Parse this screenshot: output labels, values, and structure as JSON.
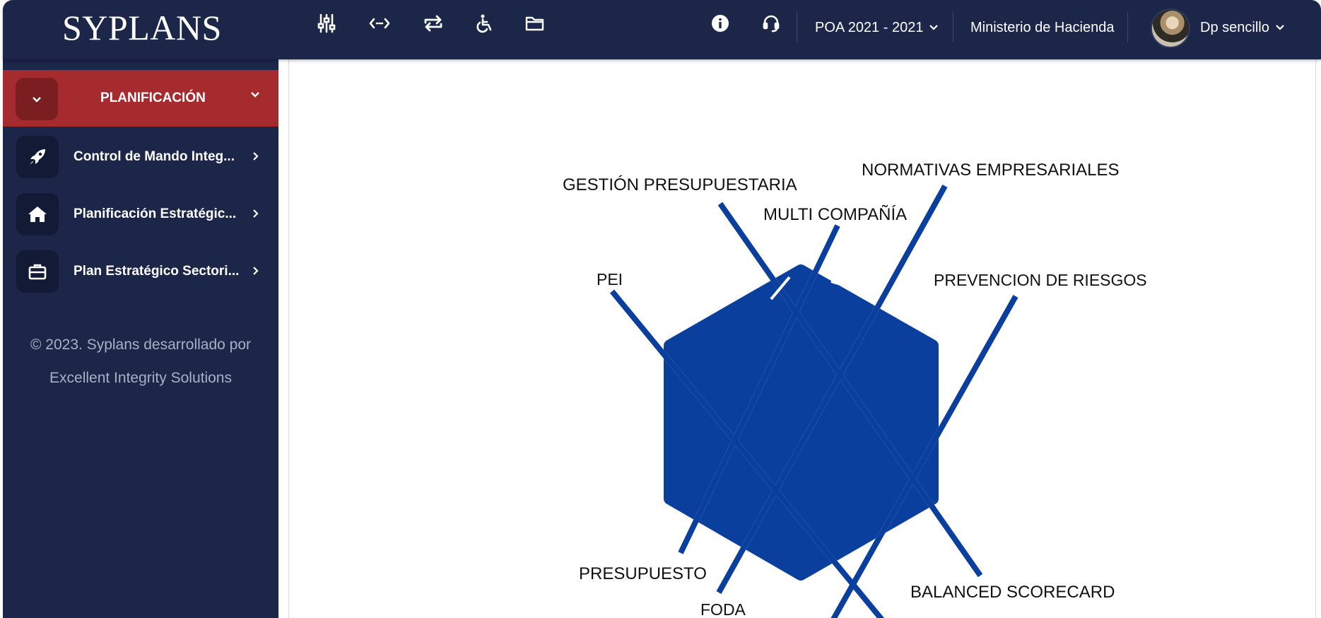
{
  "app": {
    "logo": "SYPLANS"
  },
  "toolbar": {
    "icons": [
      "sliders-icon",
      "arrows-horizontal-icon",
      "repeat-icon",
      "wheelchair-icon",
      "folder-icon"
    ]
  },
  "header": {
    "period": "POA 2021 - 2021",
    "organization": "Ministerio de Hacienda",
    "user": "Dp sencillo"
  },
  "sidebar": {
    "active": {
      "label": "PLANIFICACIÓN"
    },
    "items": [
      {
        "label": "Control de Mando Integ...",
        "icon": "rocket-icon"
      },
      {
        "label": "Planificación Estratégic...",
        "icon": "home-icon"
      },
      {
        "label": "Plan Estratégico Sectori...",
        "icon": "briefcase-icon"
      }
    ],
    "footer": {
      "line1": "© 2023. Syplans desarrollado por",
      "line2": "Excellent Integrity Solutions"
    }
  },
  "diagram": {
    "color": "#0b3f9e",
    "labels": {
      "gestion": "GESTIÓN PRESUPUESTARIA",
      "normativas": "NORMATIVAS EMPRESARIALES",
      "multi": "MULTI COMPAÑÍA",
      "pei": "PEI",
      "prevencion": "PREVENCION DE RIESGOS",
      "presupuesto": "PRESUPUESTO",
      "foda": "FODA",
      "balanced": "BALANCED SCORECARD"
    }
  }
}
